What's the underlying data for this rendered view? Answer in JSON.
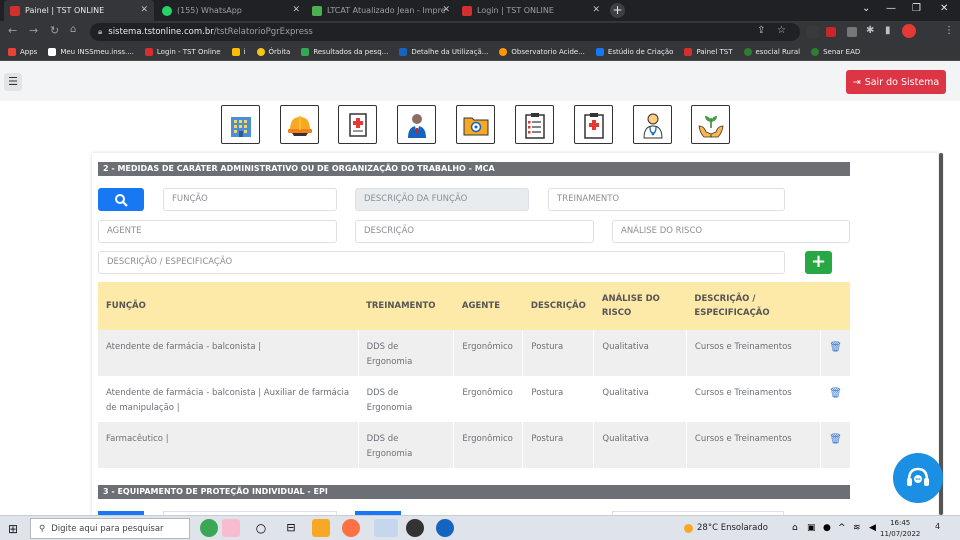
{
  "browser": {
    "tabs": [
      {
        "title": "Painel | TST ONLINE",
        "active": true,
        "favicon_color": "#d32f2f"
      },
      {
        "title": "(155) WhatsApp",
        "active": false,
        "favicon_color": "#25d366"
      },
      {
        "title": "LTCAT Atualizado Jean - Impress",
        "active": false,
        "favicon_color": "#4caf50"
      },
      {
        "title": "Login | TST ONLINE",
        "active": false,
        "favicon_color": "#d32f2f"
      }
    ],
    "new_tab_label": "+",
    "window_controls": [
      "⌄",
      "—",
      "❐",
      "✕"
    ],
    "url_host": "sistema.tstonline.com.br",
    "url_path": "/tstRelatorioPgrExpress",
    "bookmarks": [
      {
        "label": "Apps",
        "color": "#ea4335"
      },
      {
        "label": "Meu INSSmeu.inss....",
        "color": "#555"
      },
      {
        "label": "Login - TST Online",
        "color": "#d32f2f"
      },
      {
        "label": "i",
        "color": "#fbbc04"
      },
      {
        "label": "Órbita",
        "color": "#f5c518"
      },
      {
        "label": "Resultados da pesq...",
        "color": "#34a853"
      },
      {
        "label": "Detalhe da Utilizaçã...",
        "color": "#1565c0"
      },
      {
        "label": "Observatorio Acide...",
        "color": "#ff9800"
      },
      {
        "label": "Estúdio de Criação",
        "color": "#1877f2"
      },
      {
        "label": "Painel TST",
        "color": "#d32f2f"
      },
      {
        "label": "esocial Rural",
        "color": "#2e7d32"
      },
      {
        "label": "Senar EAD",
        "color": "#2e7d32"
      }
    ]
  },
  "header": {
    "logout_label": "Sair do Sistema"
  },
  "modules": [
    {
      "icon": "building-icon"
    },
    {
      "icon": "hard-hat-icon"
    },
    {
      "icon": "medical-document-icon"
    },
    {
      "icon": "worker-icon"
    },
    {
      "icon": "folder-icon"
    },
    {
      "icon": "clipboard-checklist-icon"
    },
    {
      "icon": "medical-clipboard-icon"
    },
    {
      "icon": "doctor-icon"
    },
    {
      "icon": "plant-hands-icon"
    }
  ],
  "section2": {
    "title": "2 - MEDIDAS DE CARÁTER ADMINISTRATIVO OU DE ORGANIZAÇÃO DO TRABALHO - MCA",
    "placeholders": {
      "funcao": "FUNÇÃO",
      "descricao_funcao": "DESCRIÇÃO DA FUNÇÃO",
      "treinamento": "TREINAMENTO",
      "agente": "AGENTE",
      "descricao": "DESCRIÇÃO",
      "analise_risco": "ANÁLISE DO RISCO",
      "descricao_especificacao": "DESCRIÇÃO / ESPECIFICAÇÃO"
    },
    "add_label": "+",
    "table": {
      "headers": [
        "FUNÇÃO",
        "TREINAMENTO",
        "AGENTE",
        "DESCRIÇÃO",
        "ANÁLISE DO RISCO",
        "DESCRIÇÃO / ESPECIFICAÇÃO",
        ""
      ],
      "rows": [
        {
          "funcao": "Atendente de farmácia - balconista |",
          "treinamento": "DDS de Ergonomia",
          "agente": "Ergonômico",
          "descricao": "Postura",
          "analise": "Qualitativa",
          "especificacao": "Cursos e Treinamentos"
        },
        {
          "funcao": "Atendente de farmácia - balconista | Auxiliar de farmácia de manipulação |",
          "treinamento": "DDS de Ergonomia",
          "agente": "Ergonômico",
          "descricao": "Postura",
          "analise": "Qualitativa",
          "especificacao": "Cursos e Treinamentos"
        },
        {
          "funcao": "Farmacêutico |",
          "treinamento": "DDS de Ergonomia",
          "agente": "Ergonômico",
          "descricao": "Postura",
          "analise": "Qualitativa",
          "especificacao": "Cursos e Treinamentos"
        }
      ]
    }
  },
  "section3": {
    "title": "3 - EQUIPAMENTO DE PROTEÇÃO INDIVIDUAL - EPI"
  },
  "taskbar": {
    "search_placeholder": "Digite aqui para pesquisar",
    "weather": "28°C  Ensolarado",
    "time": "16:45",
    "date": "11/07/2022",
    "notification_count": "4"
  }
}
